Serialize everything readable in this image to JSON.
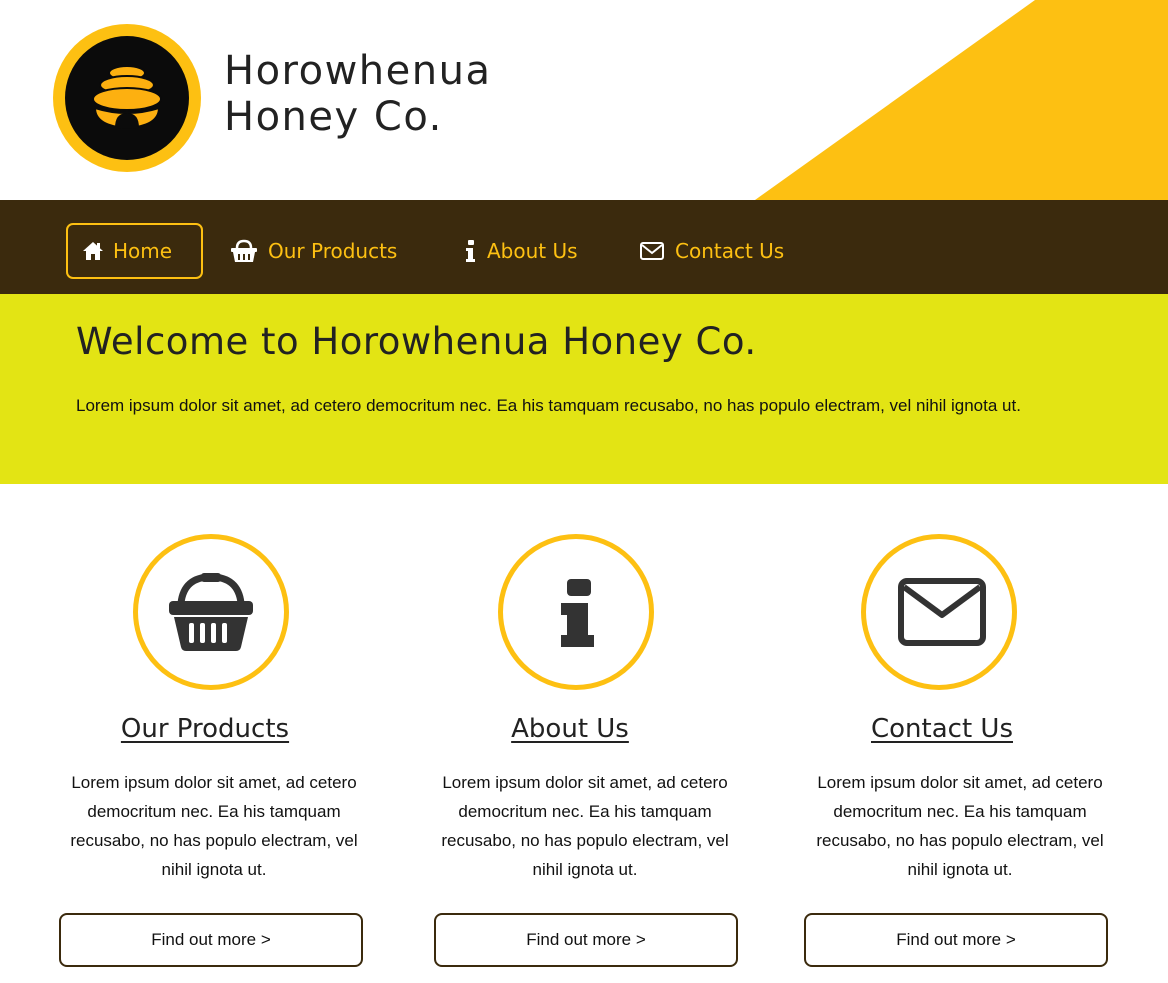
{
  "brand": {
    "line1": "Horowhenua",
    "line2": "Honey Co.",
    "logo_icon": "beehive-icon"
  },
  "nav": {
    "items": [
      {
        "label": "Home",
        "icon": "home-icon",
        "active": true
      },
      {
        "label": "Our Products",
        "icon": "basket-icon",
        "active": false
      },
      {
        "label": "About Us",
        "icon": "info-icon",
        "active": false
      },
      {
        "label": "Contact Us",
        "icon": "envelope-icon",
        "active": false
      }
    ]
  },
  "hero": {
    "title": "Welcome to Horowhenua Honey Co.",
    "text": "Lorem ipsum dolor sit amet, ad cetero democritum nec. Ea his tamquam recusabo, no has populo electram, vel nihil ignota ut."
  },
  "features": [
    {
      "title": "Our Products",
      "icon": "basket-icon",
      "text": "Lorem ipsum dolor sit amet, ad cetero democritum nec. Ea his tamquam recusabo, no has populo electram, vel nihil ignota ut.",
      "button": "Find out more >"
    },
    {
      "title": "About Us",
      "icon": "info-icon",
      "text": "Lorem ipsum dolor sit amet, ad cetero democritum nec. Ea his tamquam recusabo, no has populo electram, vel nihil ignota ut.",
      "button": "Find out more >"
    },
    {
      "title": "Contact Us",
      "icon": "envelope-icon",
      "text": "Lorem ipsum dolor sit amet, ad cetero democritum nec. Ea his tamquam recusabo, no has populo electram, vel nihil ignota ut.",
      "button": "Find out more >"
    }
  ],
  "colors": {
    "accent": "#fdc012",
    "nav_bg": "#3b2a0d",
    "hero_bg": "#e3e414",
    "icon_dark": "#333333"
  }
}
